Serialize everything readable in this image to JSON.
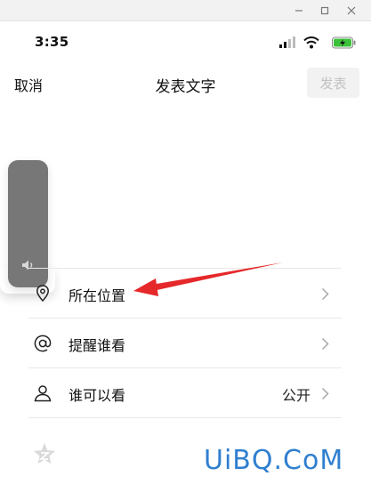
{
  "window": {
    "minimize_icon": "minimize-icon",
    "maximize_icon": "maximize-icon",
    "close_icon": "close-icon"
  },
  "status_bar": {
    "time": "3:35",
    "signal_icon": "cellular-signal-icon",
    "wifi_icon": "wifi-icon",
    "battery_icon": "battery-charging-icon",
    "battery_color": "#3cc13b"
  },
  "nav": {
    "cancel_label": "取消",
    "title": "发表文字",
    "publish_label": "发表"
  },
  "volume_hud": {
    "icon": "speaker-icon",
    "color": "#777777"
  },
  "options": [
    {
      "icon": "location-pin-icon",
      "label": "所在位置",
      "value": ""
    },
    {
      "icon": "at-sign-icon",
      "label": "提醒谁看",
      "value": ""
    },
    {
      "icon": "person-icon",
      "label": "谁可以看",
      "value": "公开"
    }
  ],
  "annotation": {
    "arrow_color": "#e5282a",
    "arrow_icon": "red-arrow-pointer"
  },
  "watermark": {
    "text": "UiBQ.CoM",
    "color": "#2f7fd0"
  }
}
